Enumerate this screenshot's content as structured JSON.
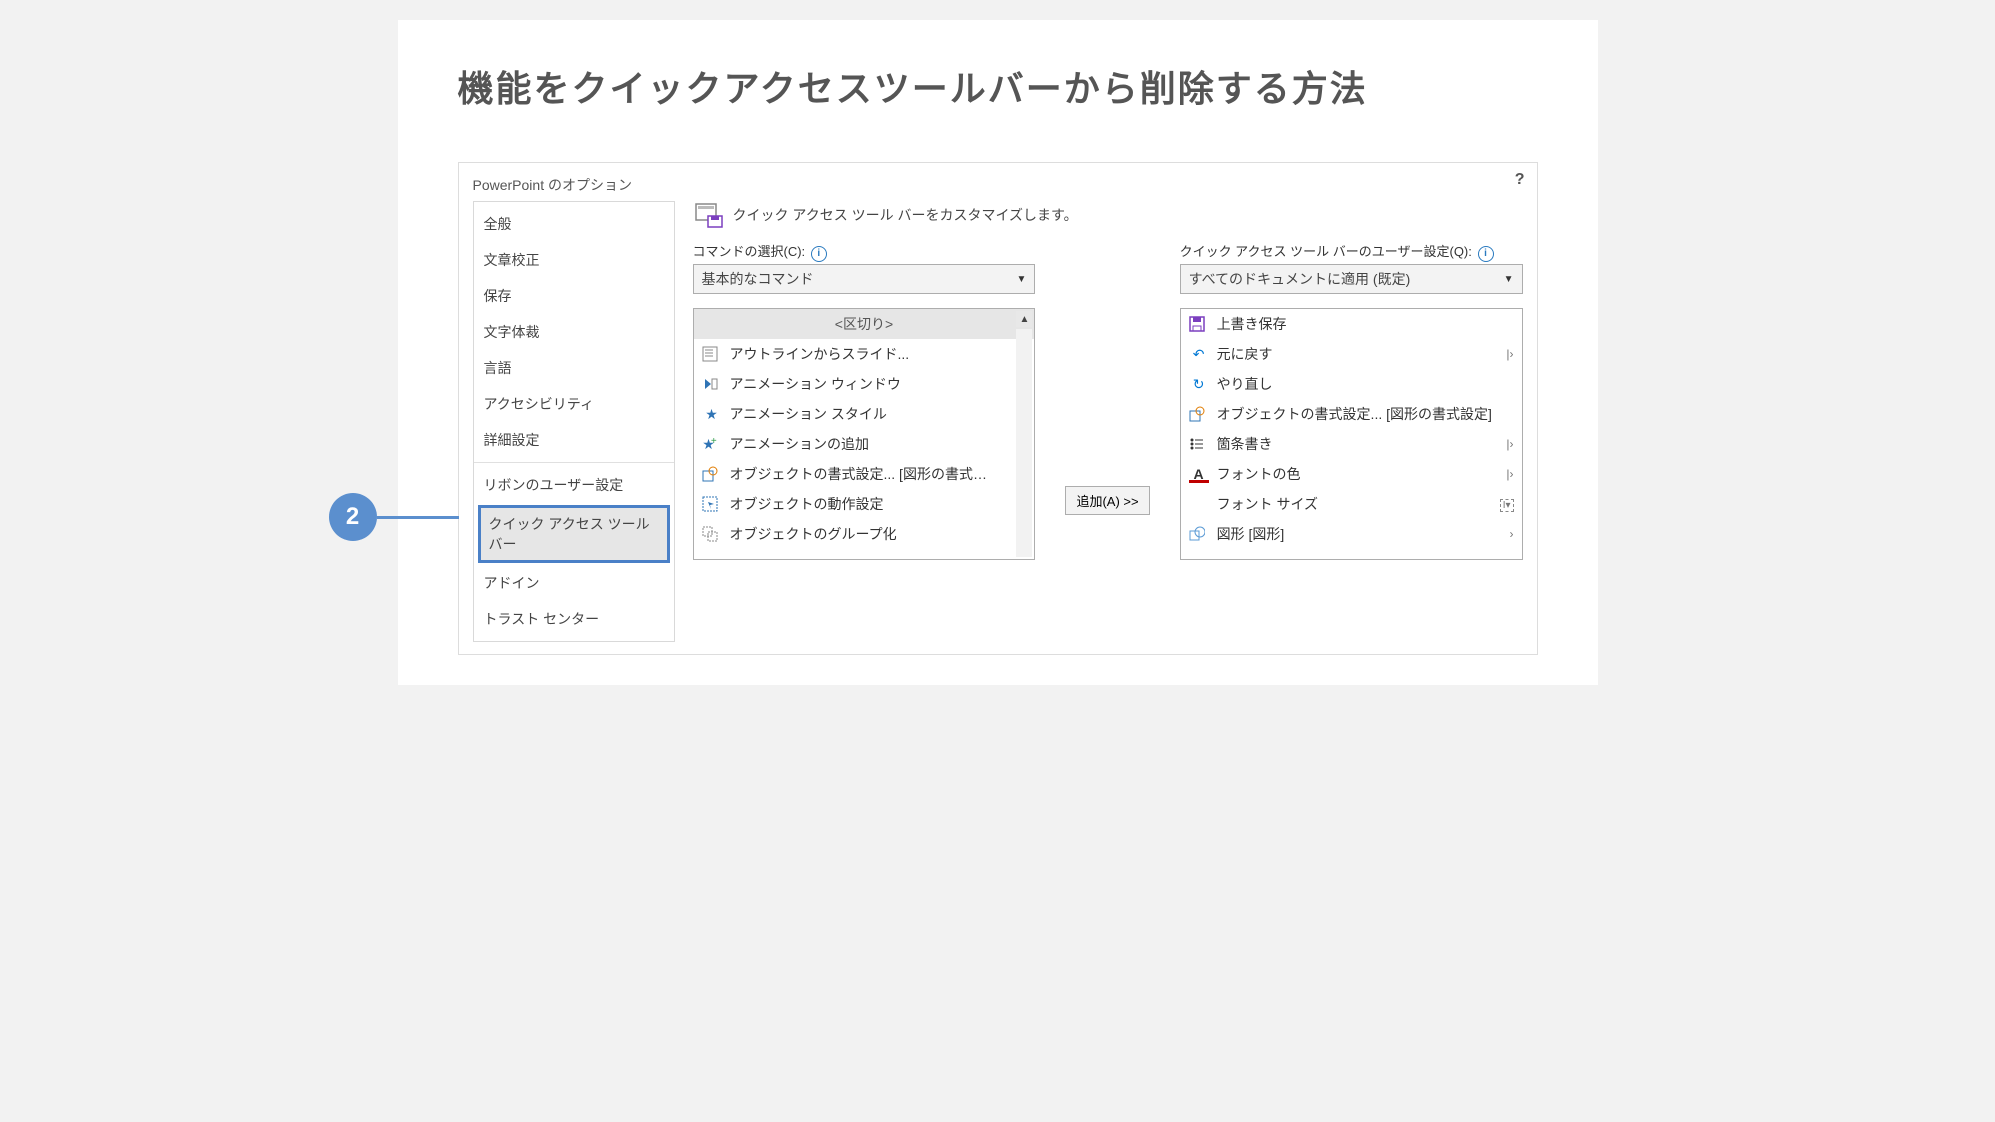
{
  "page_title": "機能をクイックアクセスツールバーから削除する方法",
  "sidebar": {
    "items": [
      "全般",
      "文章校正",
      "保存",
      "文字体裁",
      "言語",
      "アクセシビリティ",
      "詳細設定"
    ],
    "items2": [
      "リボンのユーザー設定",
      "クイック アクセス ツール バー",
      "アドイン",
      "トラスト センター"
    ],
    "highlight_index": 1
  },
  "callout_number": "2",
  "dialog": {
    "title": "PowerPoint のオプション",
    "help": "?",
    "header_label": "クイック アクセス ツール バーをカスタマイズします。"
  },
  "left_panel": {
    "label": "コマンドの選択(C):",
    "dropdown": "基本的なコマンド",
    "items": [
      {
        "icon": "",
        "label": "<区切り>",
        "sep": true
      },
      {
        "icon": "outline",
        "label": "アウトラインからスライド..."
      },
      {
        "icon": "anim-window",
        "label": "アニメーション ウィンドウ"
      },
      {
        "icon": "star",
        "label": "アニメーション スタイル",
        "chev": true
      },
      {
        "icon": "star-add",
        "label": "アニメーションの追加",
        "chev": true
      },
      {
        "icon": "format",
        "label": "オブジェクトの書式設定... [図形の書式…"
      },
      {
        "icon": "action",
        "label": "オブジェクトの動作設定"
      },
      {
        "icon": "group",
        "label": "オブジェクトのグループ化"
      }
    ]
  },
  "right_panel": {
    "label": "クイック アクセス ツール バーのユーザー設定(Q):",
    "dropdown": "すべてのドキュメントに適用 (既定)",
    "items": [
      {
        "icon": "save",
        "label": "上書き保存"
      },
      {
        "icon": "undo",
        "label": "元に戻す",
        "split": true
      },
      {
        "icon": "redo",
        "label": "やり直し"
      },
      {
        "icon": "format",
        "label": "オブジェクトの書式設定... [図形の書式設定]"
      },
      {
        "icon": "bullet",
        "label": "箇条書き",
        "split": true
      },
      {
        "icon": "fontcolor",
        "label": "フォントの色",
        "split": true
      },
      {
        "icon": "fontsize",
        "label": "フォント サイズ",
        "box": true
      },
      {
        "icon": "shape",
        "label": "図形 [図形]",
        "chev": true
      }
    ]
  },
  "add_button": "追加(A) >>"
}
